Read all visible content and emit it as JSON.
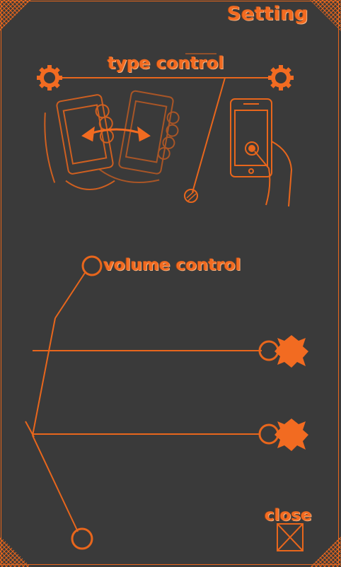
{
  "header": {
    "title": "Setting"
  },
  "type_control": {
    "label": "type control"
  },
  "volume_control": {
    "label": "volume control"
  },
  "close": {
    "label": "close"
  },
  "colors": {
    "background": "#3a3a3a",
    "accent": "#f26b21",
    "line": "#e8661c"
  },
  "icons": [
    "gear-icon",
    "tilt-phone-illustration",
    "touch-phone-illustration",
    "x-slider-knob-icon",
    "close-box-icon"
  ]
}
